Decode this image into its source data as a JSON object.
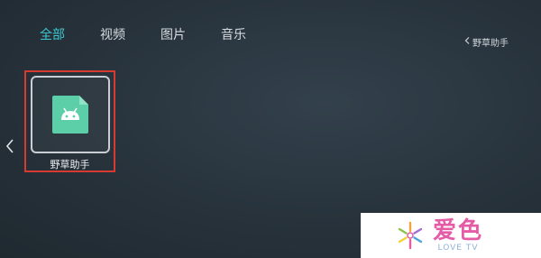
{
  "tabs": [
    {
      "label": "全部",
      "active": true
    },
    {
      "label": "视频",
      "active": false
    },
    {
      "label": "图片",
      "active": false
    },
    {
      "label": "音乐",
      "active": false
    }
  ],
  "breadcrumb": {
    "icon": "chevron-left-icon",
    "text": "野草助手"
  },
  "nav": {
    "left_icon": "chevron-left-icon"
  },
  "files": [
    {
      "label": "野草助手",
      "icon": "android-file-icon",
      "icon_color": "#5ccfa9",
      "selected": true
    }
  ],
  "colors": {
    "accent": "#3ec7d0",
    "highlight": "#d63a30"
  },
  "watermark": {
    "main": "爱色",
    "sub": "LOVE TV"
  }
}
